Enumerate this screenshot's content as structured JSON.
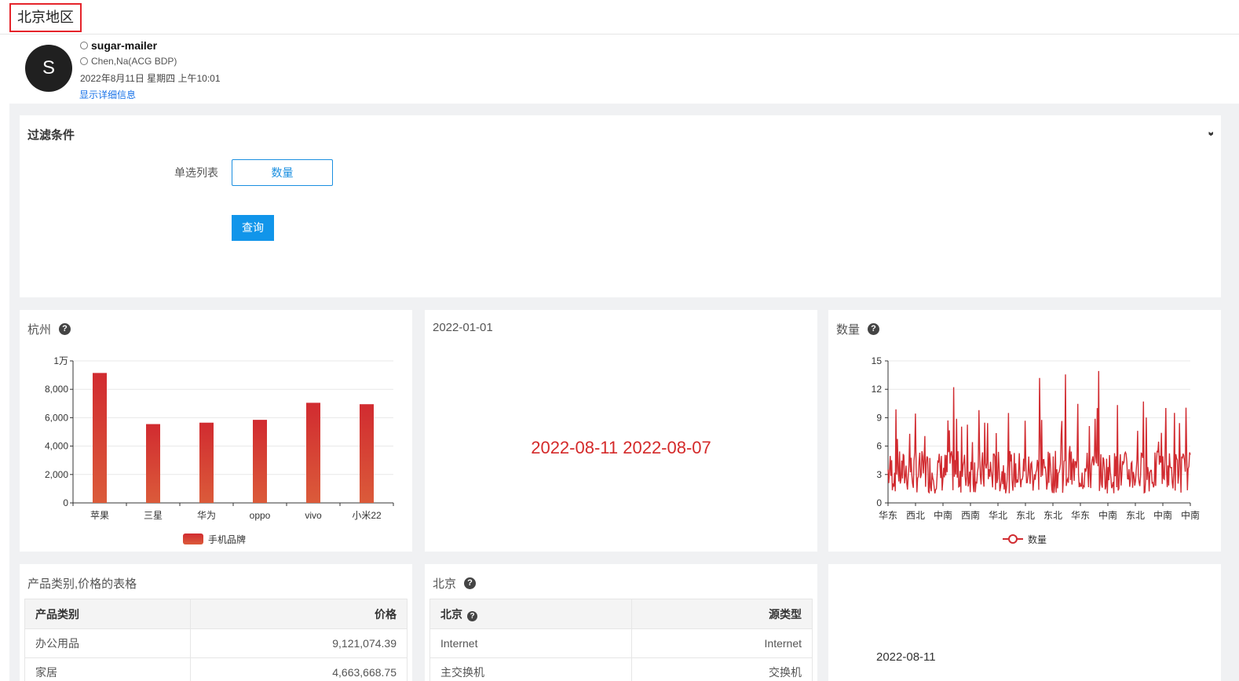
{
  "page_title": "北京地区",
  "mail": {
    "avatar_letter": "S",
    "sender": "sugar-mailer",
    "recipient": "Chen,Na(ACG BDP)",
    "date": "2022年8月11日 星期四 上午10:01",
    "details_link": "显示详细信息"
  },
  "filter": {
    "title": "过滤条件",
    "label": "单选列表",
    "selected_value": "数量",
    "query_button": "查询"
  },
  "bar_panel": {
    "title": "杭州",
    "chart_data": {
      "type": "bar",
      "categories": [
        "苹果",
        "三星",
        "华为",
        "oppo",
        "vivo",
        "小米22"
      ],
      "series": [
        {
          "name": "手机品牌",
          "values": [
            9150,
            5550,
            5650,
            5850,
            7050,
            6950
          ]
        }
      ],
      "ylim": [
        0,
        10000
      ],
      "yticks": [
        0,
        2000,
        4000,
        6000,
        8000,
        10000
      ],
      "ytick_labels": [
        "0",
        "2,000",
        "4,000",
        "6,000",
        "8,000",
        "1万"
      ],
      "bar_color_top": "#d12b30",
      "bar_color_bottom": "#db5b3a"
    }
  },
  "date_panel": {
    "caption": "2022-01-01",
    "range_text": "2022-08-11 2022-08-07",
    "range_color": "#d42a2a"
  },
  "line_panel": {
    "title": "数量",
    "chart_data": {
      "type": "line",
      "series": [
        {
          "name": "数量"
        }
      ],
      "ylim": [
        0,
        15
      ],
      "yticks": [
        0,
        3,
        6,
        9,
        12,
        15
      ],
      "xtick_labels": [
        "华东",
        "西北",
        "中南",
        "西南",
        "华北",
        "东北",
        "东北",
        "华东",
        "中南",
        "东北",
        "中南",
        "中南"
      ],
      "color": "#d12b30"
    }
  },
  "table1": {
    "title": "产品类别,价格的表格",
    "columns": [
      "产品类别",
      "价格"
    ],
    "rows": [
      [
        "办公用品",
        "9,121,074.39"
      ],
      [
        "家居",
        "4,663,668.75"
      ]
    ]
  },
  "table2": {
    "title": "北京",
    "columns": [
      "北京",
      "源类型"
    ],
    "rows": [
      [
        "Internet",
        "Internet"
      ],
      [
        "主交换机",
        "交换机"
      ]
    ]
  },
  "text_panel": {
    "date": "2022-08-11"
  }
}
